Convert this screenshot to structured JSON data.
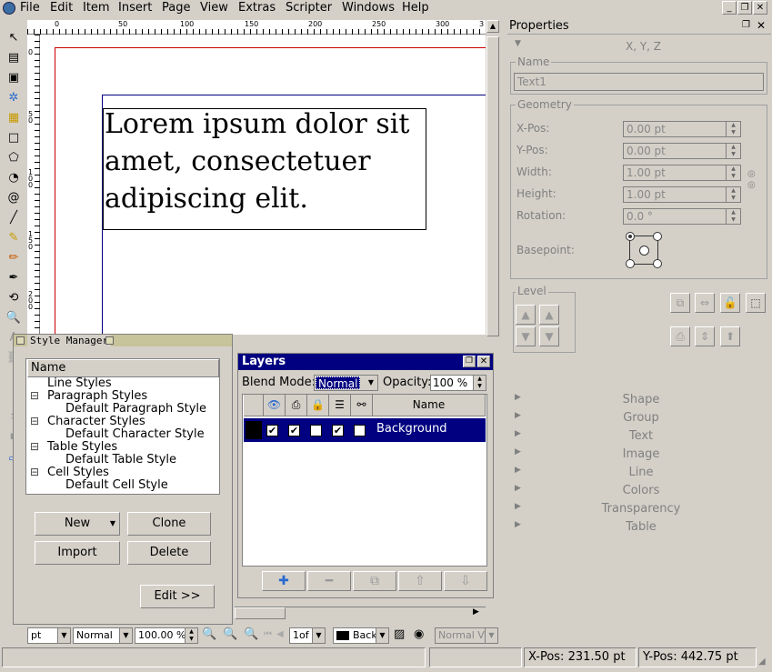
{
  "menubar": {
    "items": [
      "File",
      "Edit",
      "Item",
      "Insert",
      "Page",
      "View",
      "Extras",
      "Scripter",
      "Windows",
      "Help"
    ]
  },
  "ruler": {
    "h_ticks": [
      "0",
      "50",
      "100",
      "150",
      "200",
      "250",
      "300",
      "3"
    ],
    "v_ticks": [
      "0",
      "5\n0",
      "1\n0\n0",
      "1\n5\n0",
      "2\n0\n0"
    ]
  },
  "canvas": {
    "text_lines": [
      "Lorem ipsum dolor sit",
      "amet, consectetuer",
      "adipiscing elit."
    ]
  },
  "properties": {
    "title": "Properties",
    "xyz_label": "X, Y, Z",
    "name_group": "Name",
    "name_value": "Text1",
    "geometry_group": "Geometry",
    "fields": [
      {
        "label": "X-Pos:",
        "value": "0.00 pt"
      },
      {
        "label": "Y-Pos:",
        "value": "0.00 pt"
      },
      {
        "label": "Width:",
        "value": "1.00 pt"
      },
      {
        "label": "Height:",
        "value": "1.00 pt"
      },
      {
        "label": "Rotation:",
        "value": "0.0 °"
      }
    ],
    "basepoint_label": "Basepoint:",
    "level_group": "Level",
    "sections": [
      "Shape",
      "Group",
      "Text",
      "Image",
      "Line",
      "Colors",
      "Transparency",
      "Table"
    ]
  },
  "style_manager": {
    "title": "Style Manager",
    "header": "Name",
    "tree": [
      {
        "label": "Line Styles",
        "level": 0,
        "expander": ""
      },
      {
        "label": "Paragraph Styles",
        "level": 0,
        "expander": "⊟"
      },
      {
        "label": "Default Paragraph Style",
        "level": 1,
        "expander": ""
      },
      {
        "label": "Character Styles",
        "level": 0,
        "expander": "⊟"
      },
      {
        "label": "Default Character Style",
        "level": 1,
        "expander": ""
      },
      {
        "label": "Table Styles",
        "level": 0,
        "expander": "⊟"
      },
      {
        "label": "Default Table Style",
        "level": 1,
        "expander": ""
      },
      {
        "label": "Cell Styles",
        "level": 0,
        "expander": "⊟"
      },
      {
        "label": "Default Cell Style",
        "level": 1,
        "expander": ""
      }
    ],
    "buttons": {
      "new": "New",
      "clone": "Clone",
      "import": "Import",
      "delete": "Delete",
      "edit": "Edit >>"
    }
  },
  "layers": {
    "title": "Layers",
    "blend_label": "Blend Mode:",
    "blend_value": "Normal",
    "opacity_label": "Opacity:",
    "opacity_value": "100 %",
    "name_header": "Name",
    "rows": [
      {
        "name": "Background",
        "visible": "✔",
        "printable": "✔",
        "locked": "",
        "flow": "✔",
        "outline": ""
      }
    ],
    "color": "#000000"
  },
  "bottom_bar": {
    "unit": "pt",
    "mode": "Normal",
    "zoom": "100.00 %",
    "page": "1of",
    "layer": "Back",
    "view_mode": "Normal Vi"
  },
  "status": {
    "xpos_label": "X-Pos:",
    "xpos_value": "231.50 pt",
    "ypos_label": "Y-Pos:",
    "ypos_value": "442.75 pt"
  },
  "colors": {
    "selection": "#000080",
    "page_margin": "#cc0000",
    "frame_line": "#000080"
  }
}
